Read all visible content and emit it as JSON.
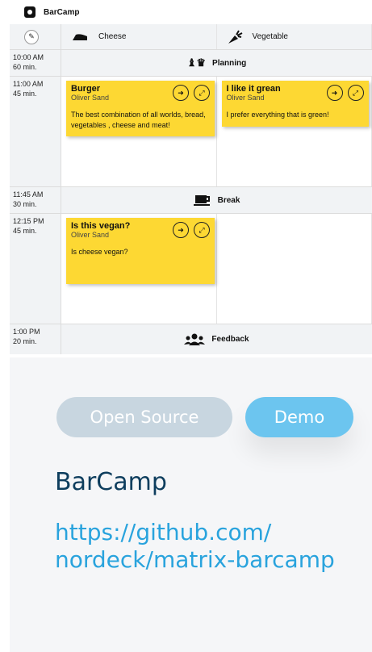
{
  "app": {
    "title": "BarCamp"
  },
  "tracks": [
    {
      "name": "Cheese",
      "icon": "cheese-icon"
    },
    {
      "name": "Vegetable",
      "icon": "carrot-icon"
    }
  ],
  "slots": [
    {
      "time": "10:00 AM",
      "duration": "60 min.",
      "label": "Planning",
      "icon": "chess-icon"
    },
    {
      "time": "11:00 AM",
      "duration": "45 min."
    },
    {
      "time": "11:45 AM",
      "duration": "30 min.",
      "label": "Break",
      "icon": "coffee-icon"
    },
    {
      "time": "12:15 PM",
      "duration": "45 min."
    },
    {
      "time": "1:00 PM",
      "duration": "20 min.",
      "label": "Feedback",
      "icon": "users-icon"
    }
  ],
  "sessions": [
    {
      "title": "Burger",
      "author": "Oliver Sand",
      "description": "The best combination of all worlds, bread, vegetables , cheese and meat!"
    },
    {
      "title": "I like it grean",
      "author": "Oliver Sand",
      "description": "I prefer everything that is green!"
    },
    {
      "title": "Is this vegan?",
      "author": "Oliver Sand",
      "description": "Is cheese vegan?"
    }
  ],
  "buttons": {
    "open_source": "Open Source",
    "demo": "Demo"
  },
  "project": {
    "name": "BarCamp",
    "link": "https://github.com/ nordeck/matrix-barcamp"
  },
  "colors": {
    "card": "#fdd833",
    "link": "#29a3dd",
    "title": "#0e3e5e",
    "demo": "#6cc5ef",
    "open_source": "#c8d6e0"
  }
}
